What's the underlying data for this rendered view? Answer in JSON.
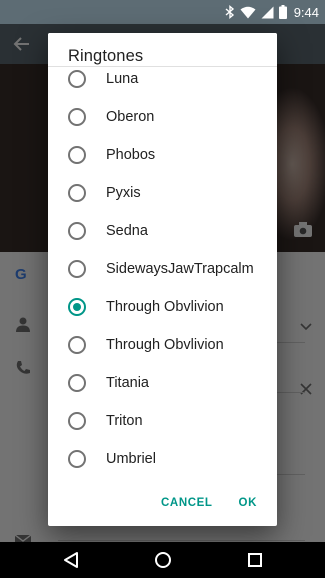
{
  "status_bar": {
    "time": "9:44"
  },
  "dialog": {
    "title": "Ringtones",
    "options": [
      {
        "label": "Luna",
        "selected": false
      },
      {
        "label": "Oberon",
        "selected": false
      },
      {
        "label": "Phobos",
        "selected": false
      },
      {
        "label": "Pyxis",
        "selected": false
      },
      {
        "label": "Sedna",
        "selected": false
      },
      {
        "label": "SidewaysJawTrapcalm",
        "selected": false
      },
      {
        "label": "Through Obvlivion",
        "selected": true
      },
      {
        "label": "Through Obvlivion",
        "selected": false
      },
      {
        "label": "Titania",
        "selected": false
      },
      {
        "label": "Triton",
        "selected": false
      },
      {
        "label": "Umbriel",
        "selected": false
      }
    ],
    "cancel_label": "CANCEL",
    "ok_label": "OK"
  },
  "colors": {
    "accent": "#009688",
    "toolbar": "#5d6c74"
  }
}
